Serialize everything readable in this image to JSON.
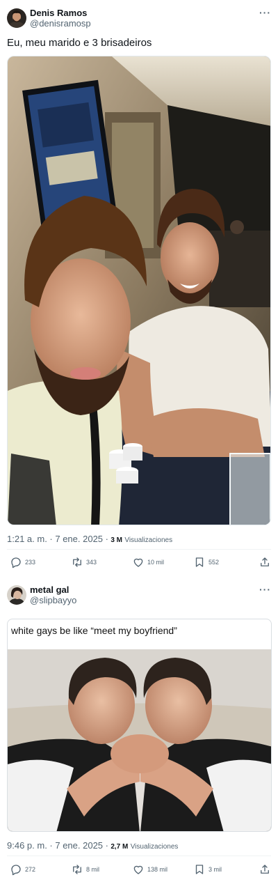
{
  "tweets": [
    {
      "author": {
        "name": "Denis Ramos",
        "handle": "@denisramosp"
      },
      "text": "Eu, meu marido e 3 brisadeiros",
      "timestamp": "1:21 a. m. · 7 ene. 2025 ·",
      "views_count": "3 M",
      "views_label": "Visualizaciones",
      "stats": {
        "replies": "233",
        "retweets": "343",
        "likes": "10 mil",
        "bookmarks": "552"
      },
      "icons": [
        "reply-icon",
        "retweet-icon",
        "like-icon",
        "bookmark-icon",
        "share-icon"
      ]
    },
    {
      "author": {
        "name": "metal gal",
        "handle": "@slipbayyo"
      },
      "quoted_text": "white gays be like “meet my boyfriend”",
      "timestamp": "9:46 p. m. · 7 ene. 2025 ·",
      "views_count": "2,7 M",
      "views_label": "Visualizaciones",
      "stats": {
        "replies": "272",
        "retweets": "8 mil",
        "likes": "138 mil",
        "bookmarks": "3 mil"
      },
      "icons": [
        "reply-icon",
        "retweet-icon",
        "like-icon",
        "bookmark-icon",
        "share-icon"
      ]
    }
  ],
  "more_icon": "···",
  "colors": {
    "text": "#0f1419",
    "secondary": "#536471",
    "separator": "#eff3f4"
  }
}
